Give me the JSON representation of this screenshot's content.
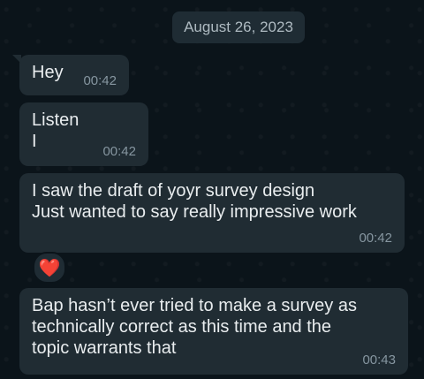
{
  "chat": {
    "date": "August 26, 2023",
    "messages": [
      {
        "text": "Hey",
        "time": "00:42"
      },
      {
        "text": "Listen\nI",
        "time": "00:42"
      },
      {
        "text": "I saw the draft of yoyr survey design\nJust wanted to say really impressive work",
        "time": "00:42",
        "reaction": "❤️"
      },
      {
        "text": "Bap hasn’t ever tried to make a survey as\ntechnically correct as this time and the\ntopic warrants that",
        "time": "00:43"
      }
    ]
  },
  "colors": {
    "background": "#0b141a",
    "bubble": "#202c33",
    "time_text": "#8696a0",
    "reaction_heart": "#f0384d"
  }
}
